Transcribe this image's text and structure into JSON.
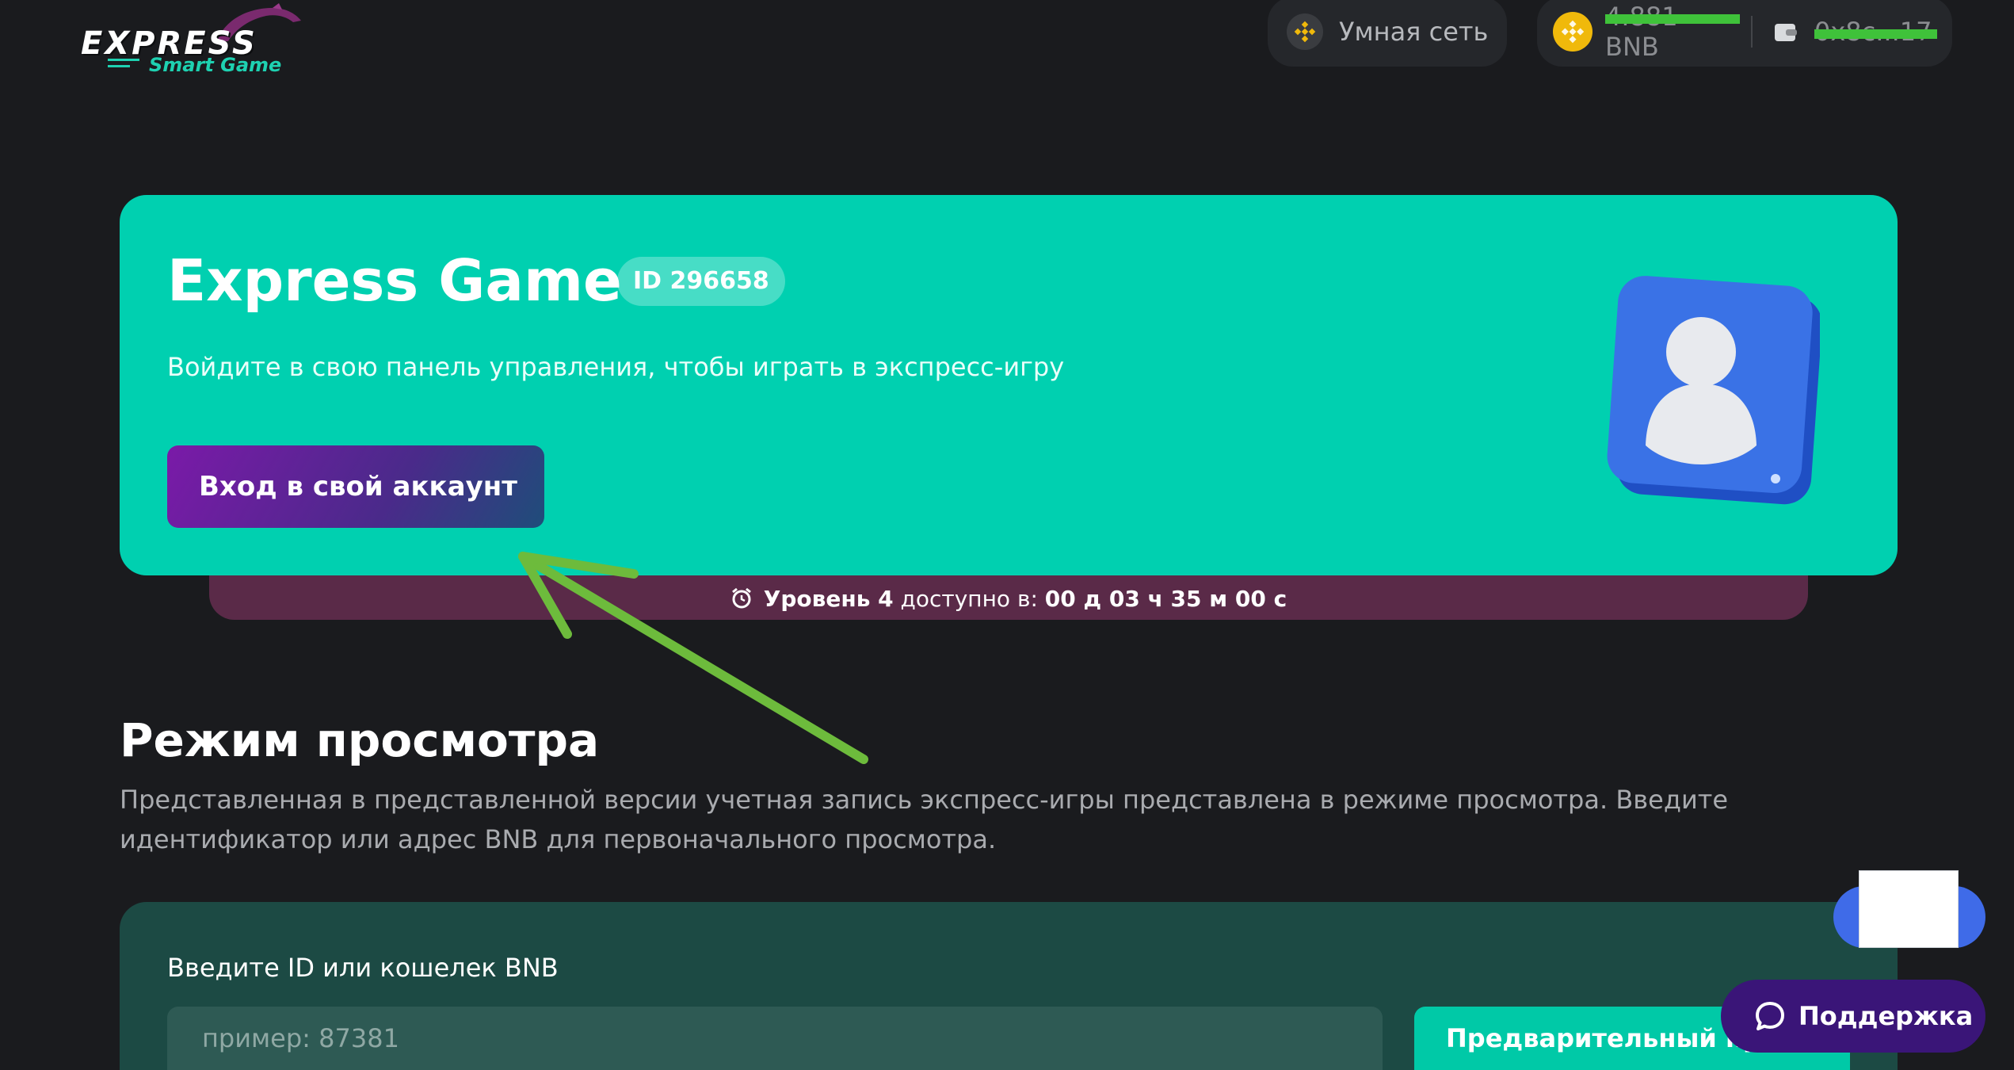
{
  "header": {
    "logo_main": "EXPRESS",
    "logo_sub": "Smart Game",
    "network_label": "Умная сеть",
    "wallet_balance": "4.881 BNB",
    "wallet_address": "0x8c...17"
  },
  "hero": {
    "title": "Express Game",
    "id_badge": "ID 296658",
    "subtitle": "Войдите в свою панель управления, чтобы играть в экспресс-игру",
    "login_button": "Вход в свой аккаунт"
  },
  "level_bar": {
    "level_text": "Уровень 4",
    "available_text": "доступно в:",
    "countdown": "00 д 03 ч 35 м 00 с"
  },
  "view_mode": {
    "title": "Режим просмотра",
    "description": "Представленная в представленной версии учетная запись экспресс-игры представлена в режиме просмотра. Введите идентификатор или адрес BNB для первоначального просмотра.",
    "input_label": "Введите ID или кошелек BNB",
    "input_placeholder": "пример: 87381",
    "preview_button": "Предварительный просмотр"
  },
  "support": {
    "label": "Поддержка"
  },
  "colors": {
    "background": "#1a1b1e",
    "hero": "#00d0b0",
    "level_bar": "#5a2a48",
    "view_card": "#1c4a44",
    "bnb": "#f0b90b",
    "support": "#3a1578",
    "annotation_arrow": "#6dbb3c"
  },
  "icons": [
    "bnb-icon",
    "wallet-icon",
    "user-avatar-icon",
    "alarm-clock-icon",
    "chat-bubble-icon"
  ]
}
